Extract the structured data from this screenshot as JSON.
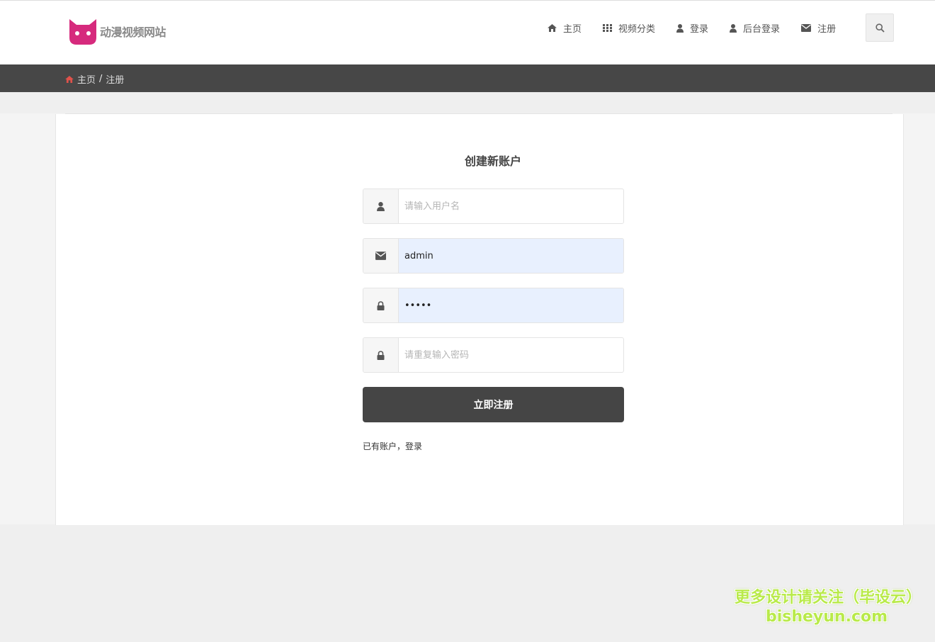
{
  "site": {
    "name": "动漫视频网站",
    "brand_color": "#d62a7d"
  },
  "nav": {
    "items": [
      {
        "label": "主页",
        "icon": "home-icon"
      },
      {
        "label": "视频分类",
        "icon": "grid-icon"
      },
      {
        "label": "登录",
        "icon": "user-icon"
      },
      {
        "label": "后台登录",
        "icon": "user-icon"
      },
      {
        "label": "注册",
        "icon": "envelope-icon"
      }
    ],
    "search_icon": "search-icon"
  },
  "breadcrumb": {
    "home": "主页",
    "separator": "/",
    "current": "注册"
  },
  "form": {
    "title": "创建新账户",
    "username": {
      "value": "",
      "placeholder": "请输入用户名",
      "icon": "user-icon"
    },
    "email": {
      "value": "admin",
      "placeholder": "",
      "icon": "envelope-icon"
    },
    "password": {
      "value": "•••••",
      "placeholder": "",
      "icon": "lock-icon"
    },
    "confirm_password": {
      "value": "",
      "placeholder": "请重复输入密码",
      "icon": "lock-icon"
    },
    "submit_label": "立即注册",
    "login_prompt": "已有账户，",
    "login_link": "登录"
  },
  "watermark": {
    "line1": "更多设计请关注（毕设云）",
    "line2": "bisheyun.com"
  },
  "colors": {
    "breadcrumb_bar": "#474747",
    "button": "#454545",
    "autofill": "#e8f0fe",
    "home_icon_accent": "#e0524b"
  }
}
